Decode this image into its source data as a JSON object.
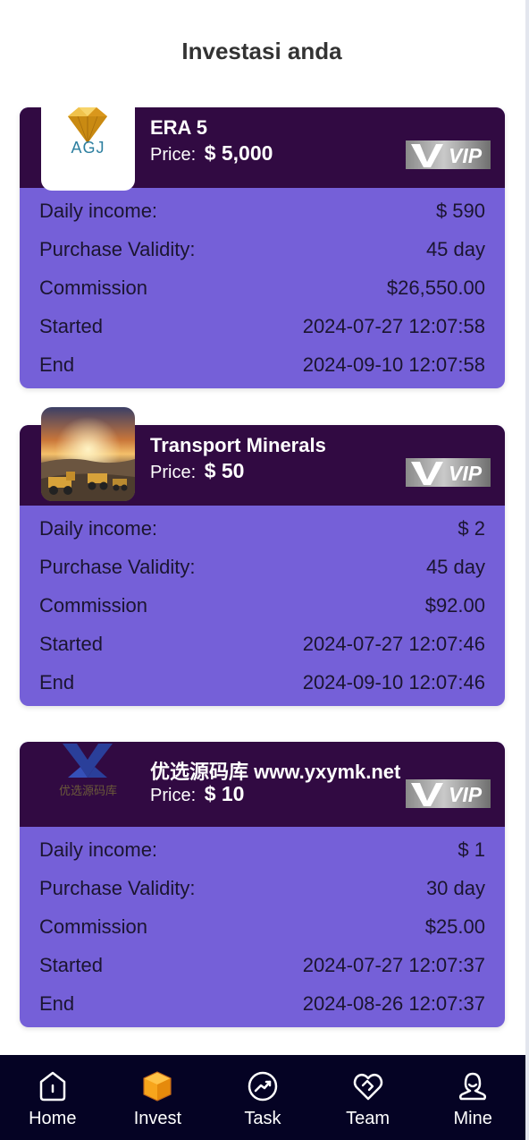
{
  "page": {
    "title": "Investasi anda"
  },
  "cards": [
    {
      "name": "ERA 5",
      "price_label": "Price:",
      "price": "$ 5,000",
      "logo_text": "AGJ",
      "vip_label": "VIP",
      "rows": [
        {
          "label": "Daily income:",
          "value": "$ 590"
        },
        {
          "label": "Purchase Validity:",
          "value": "45 day"
        },
        {
          "label": "Commission",
          "value": "$26,550.00"
        },
        {
          "label": "Started",
          "value": "2024-07-27 12:07:58"
        },
        {
          "label": "End",
          "value": "2024-09-10 12:07:58"
        }
      ]
    },
    {
      "name": "Transport Minerals",
      "price_label": "Price:",
      "price": "$ 50",
      "vip_label": "VIP",
      "rows": [
        {
          "label": "Daily income:",
          "value": "$ 2"
        },
        {
          "label": "Purchase Validity:",
          "value": "45 day"
        },
        {
          "label": "Commission",
          "value": "$92.00"
        },
        {
          "label": "Started",
          "value": "2024-07-27 12:07:46"
        },
        {
          "label": "End",
          "value": "2024-09-10 12:07:46"
        }
      ]
    },
    {
      "name": "优选源码库 www.yxymk.net",
      "price_label": "Price:",
      "price": "$ 10",
      "logo_text": "优选源码库",
      "vip_label": "VIP",
      "rows": [
        {
          "label": "Daily income:",
          "value": "$ 1"
        },
        {
          "label": "Purchase Validity:",
          "value": "30 day"
        },
        {
          "label": "Commission",
          "value": "$25.00"
        },
        {
          "label": "Started",
          "value": "2024-07-27 12:07:37"
        },
        {
          "label": "End",
          "value": "2024-08-26 12:07:37"
        }
      ]
    }
  ],
  "nav": [
    {
      "label": "Home",
      "icon": "home-icon",
      "active": false
    },
    {
      "label": "Invest",
      "icon": "invest-box-icon",
      "active": true
    },
    {
      "label": "Task",
      "icon": "task-icon",
      "active": false
    },
    {
      "label": "Team",
      "icon": "team-icon",
      "active": false
    },
    {
      "label": "Mine",
      "icon": "mine-icon",
      "active": false
    }
  ],
  "colors": {
    "card_header": "#310a42",
    "card_body": "#7560d8",
    "nav_background": "#050324",
    "active_icon": "#f7a51c"
  }
}
